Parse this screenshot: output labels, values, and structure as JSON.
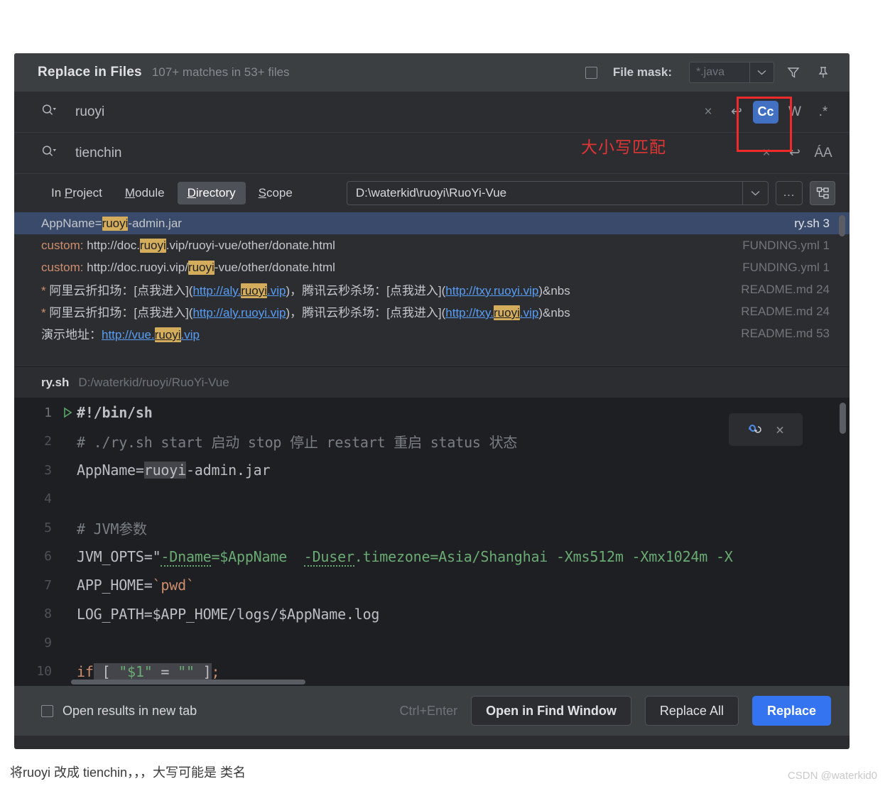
{
  "dialog": {
    "title": "Replace in Files",
    "subtitle": "107+ matches in 53+ files",
    "file_mask": {
      "label": "File mask:",
      "value": "*.java",
      "checked": false
    },
    "icons": {
      "filter": "filter-funnel-icon",
      "pin": "pin-icon"
    }
  },
  "search": {
    "find_value": "ruoyi",
    "replace_value": "tienchin",
    "find_actions": [
      {
        "name": "clear-search-icon",
        "glyph": "×"
      },
      {
        "name": "multiline-toggle-icon",
        "glyph": "↩"
      },
      {
        "name": "match-case-toggle",
        "glyph": "Cc",
        "active": true
      },
      {
        "name": "words-toggle",
        "glyph": "W"
      },
      {
        "name": "regex-toggle",
        "glyph": ".*"
      }
    ],
    "replace_actions": [
      {
        "name": "clear-replace-icon",
        "glyph": "×"
      },
      {
        "name": "multiline-replace-toggle-icon",
        "glyph": "↩"
      },
      {
        "name": "preserve-case-toggle",
        "glyph": "ÁA"
      }
    ]
  },
  "annotation": {
    "note": "大小写匹配"
  },
  "scope": {
    "options": [
      {
        "label": "In Project",
        "mnemonic": "P",
        "active": false
      },
      {
        "label": "Module",
        "mnemonic": "M",
        "active": false
      },
      {
        "label": "Directory",
        "mnemonic": "D",
        "active": true
      },
      {
        "label": "Scope",
        "mnemonic": "S",
        "active": false
      }
    ],
    "path": "D:\\waterkid\\ruoyi\\RuoYi-Vue",
    "browse_label": "...",
    "tree_icon": "module-tree-icon"
  },
  "results": [
    {
      "selected": true,
      "segments": [
        {
          "t": "AppName=",
          "s": "plain"
        },
        {
          "t": "ruoyi",
          "s": "hl"
        },
        {
          "t": "-admin.jar",
          "s": "plain"
        }
      ],
      "file": "ry.sh",
      "line": "3"
    },
    {
      "selected": false,
      "segments": [
        {
          "t": "custom:",
          "s": "kw"
        },
        {
          "t": " http://doc.",
          "s": "plain"
        },
        {
          "t": "ruoyi",
          "s": "hl"
        },
        {
          "t": ".vip/ruoyi-vue/other/donate.html",
          "s": "plain"
        }
      ],
      "file": "FUNDING.yml",
      "line": "1"
    },
    {
      "selected": false,
      "segments": [
        {
          "t": "custom:",
          "s": "kw"
        },
        {
          "t": " http://doc.ruoyi.vip/",
          "s": "plain"
        },
        {
          "t": "ruoyi",
          "s": "hl"
        },
        {
          "t": "-vue/other/donate.html",
          "s": "plain"
        }
      ],
      "file": "FUNDING.yml",
      "line": "1"
    },
    {
      "selected": false,
      "segments": [
        {
          "t": "*",
          "s": "star"
        },
        {
          "t": " 阿里云折扣场：[点我进入](",
          "s": "plain"
        },
        {
          "t": "http://aly.",
          "s": "link"
        },
        {
          "t": "ruoyi",
          "s": "hl-link"
        },
        {
          "t": ".vip",
          "s": "link"
        },
        {
          "t": ")，腾讯云秒杀场：[点我进入](",
          "s": "plain"
        },
        {
          "t": "http://txy.ruoyi.vip",
          "s": "link"
        },
        {
          "t": ")&nbs",
          "s": "plain"
        }
      ],
      "file": "README.md",
      "line": "24"
    },
    {
      "selected": false,
      "segments": [
        {
          "t": "*",
          "s": "star"
        },
        {
          "t": " 阿里云折扣场：[点我进入](",
          "s": "plain"
        },
        {
          "t": "http://aly.ruoyi.vip",
          "s": "link"
        },
        {
          "t": ")，腾讯云秒杀场：[点我进入](",
          "s": "plain"
        },
        {
          "t": "http://txy.",
          "s": "link"
        },
        {
          "t": "ruoyi",
          "s": "hl-link"
        },
        {
          "t": ".vip",
          "s": "link"
        },
        {
          "t": ")&nbs",
          "s": "plain"
        }
      ],
      "file": "README.md",
      "line": "24"
    },
    {
      "selected": false,
      "segments": [
        {
          "t": "演示地址：",
          "s": "plain"
        },
        {
          "t": "http://vue.",
          "s": "link"
        },
        {
          "t": "ruoyi",
          "s": "hl-link"
        },
        {
          "t": ".vip",
          "s": "link"
        }
      ],
      "file": "README.md",
      "line": "53"
    }
  ],
  "preview": {
    "file_name": "ry.sh",
    "file_path": "D:/waterkid/ruoyi/RuoYi-Vue",
    "widget": {
      "icon": "refresh-regex-icon",
      "close": "×"
    },
    "lines": [
      {
        "num": "1",
        "runnable": true,
        "tokens": [
          {
            "t": "#!/bin/sh",
            "c": "bold"
          }
        ]
      },
      {
        "num": "2",
        "runnable": false,
        "tokens": [
          {
            "t": "# ./ry.sh start 启动 stop 停止 restart 重启 status 状态",
            "c": "cmt"
          }
        ]
      },
      {
        "num": "3",
        "runnable": false,
        "tokens": [
          {
            "t": "AppName=",
            "c": "white"
          },
          {
            "t": "ruoyi",
            "c": "white-sel"
          },
          {
            "t": "-admin.jar",
            "c": "white"
          }
        ]
      },
      {
        "num": "4",
        "runnable": false,
        "tokens": []
      },
      {
        "num": "5",
        "runnable": false,
        "tokens": [
          {
            "t": "# JVM参数",
            "c": "cmt"
          }
        ]
      },
      {
        "num": "6",
        "runnable": false,
        "tokens": [
          {
            "t": "JVM_OPTS=\"",
            "c": "white"
          },
          {
            "t": "-Dname",
            "c": "green-sq"
          },
          {
            "t": "=$AppName",
            "c": "green"
          },
          {
            "t": "  ",
            "c": "green"
          },
          {
            "t": "-Duser",
            "c": "green-sq"
          },
          {
            "t": ".timezone=Asia/Shanghai -Xms512m -Xmx1024m -X",
            "c": "green"
          }
        ]
      },
      {
        "num": "7",
        "runnable": false,
        "tokens": [
          {
            "t": "APP_HOME=",
            "c": "white"
          },
          {
            "t": "`pwd`",
            "c": "orange"
          }
        ]
      },
      {
        "num": "8",
        "runnable": false,
        "tokens": [
          {
            "t": "LOG_PATH=$APP_HOME/logs/$AppName.log",
            "c": "white"
          }
        ]
      },
      {
        "num": "9",
        "runnable": false,
        "tokens": []
      },
      {
        "num": "10",
        "runnable": false,
        "tokens": [
          {
            "t": "if",
            "c": "orange"
          },
          {
            "t": " [ ",
            "c": "white-sel"
          },
          {
            "t": "\"$1\"",
            "c": "green-sel"
          },
          {
            "t": " = ",
            "c": "white-sel"
          },
          {
            "t": "\"\"",
            "c": "green-sel"
          },
          {
            "t": " ]",
            "c": "white-sel"
          },
          {
            "t": ";",
            "c": "orange"
          }
        ]
      }
    ]
  },
  "footer": {
    "open_new_tab_label": "Open results in new tab",
    "open_new_tab_checked": false,
    "shortcut": "Ctrl+Enter",
    "open_find_window_label": "Open in Find Window",
    "replace_all_label": "Replace All",
    "replace_label": "Replace"
  },
  "page": {
    "caption": "将ruoyi 改成 tienchin，，，大写可能是 类名",
    "watermark": "CSDN @waterkid0"
  },
  "colors": {
    "accent": "#3574f0",
    "toggle_active": "#4271c4",
    "highlight": "#d3ad5b",
    "annotation": "#e03535",
    "selection_row": "#3a4a6b"
  }
}
